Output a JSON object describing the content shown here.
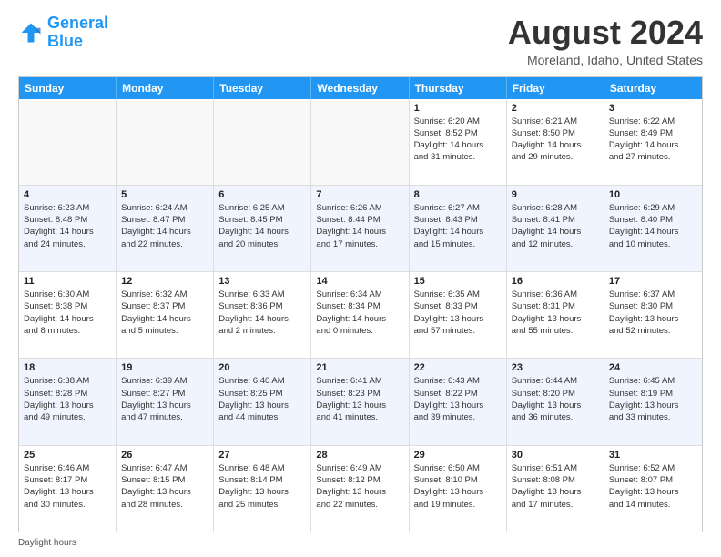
{
  "header": {
    "logo_line1": "General",
    "logo_line2": "Blue",
    "title": "August 2024",
    "subtitle": "Moreland, Idaho, United States"
  },
  "days_of_week": [
    "Sunday",
    "Monday",
    "Tuesday",
    "Wednesday",
    "Thursday",
    "Friday",
    "Saturday"
  ],
  "footer_text": "Daylight hours",
  "rows": [
    {
      "alt": false,
      "cells": [
        {
          "num": "",
          "info": ""
        },
        {
          "num": "",
          "info": ""
        },
        {
          "num": "",
          "info": ""
        },
        {
          "num": "",
          "info": ""
        },
        {
          "num": "1",
          "info": "Sunrise: 6:20 AM\nSunset: 8:52 PM\nDaylight: 14 hours\nand 31 minutes."
        },
        {
          "num": "2",
          "info": "Sunrise: 6:21 AM\nSunset: 8:50 PM\nDaylight: 14 hours\nand 29 minutes."
        },
        {
          "num": "3",
          "info": "Sunrise: 6:22 AM\nSunset: 8:49 PM\nDaylight: 14 hours\nand 27 minutes."
        }
      ]
    },
    {
      "alt": true,
      "cells": [
        {
          "num": "4",
          "info": "Sunrise: 6:23 AM\nSunset: 8:48 PM\nDaylight: 14 hours\nand 24 minutes."
        },
        {
          "num": "5",
          "info": "Sunrise: 6:24 AM\nSunset: 8:47 PM\nDaylight: 14 hours\nand 22 minutes."
        },
        {
          "num": "6",
          "info": "Sunrise: 6:25 AM\nSunset: 8:45 PM\nDaylight: 14 hours\nand 20 minutes."
        },
        {
          "num": "7",
          "info": "Sunrise: 6:26 AM\nSunset: 8:44 PM\nDaylight: 14 hours\nand 17 minutes."
        },
        {
          "num": "8",
          "info": "Sunrise: 6:27 AM\nSunset: 8:43 PM\nDaylight: 14 hours\nand 15 minutes."
        },
        {
          "num": "9",
          "info": "Sunrise: 6:28 AM\nSunset: 8:41 PM\nDaylight: 14 hours\nand 12 minutes."
        },
        {
          "num": "10",
          "info": "Sunrise: 6:29 AM\nSunset: 8:40 PM\nDaylight: 14 hours\nand 10 minutes."
        }
      ]
    },
    {
      "alt": false,
      "cells": [
        {
          "num": "11",
          "info": "Sunrise: 6:30 AM\nSunset: 8:38 PM\nDaylight: 14 hours\nand 8 minutes."
        },
        {
          "num": "12",
          "info": "Sunrise: 6:32 AM\nSunset: 8:37 PM\nDaylight: 14 hours\nand 5 minutes."
        },
        {
          "num": "13",
          "info": "Sunrise: 6:33 AM\nSunset: 8:36 PM\nDaylight: 14 hours\nand 2 minutes."
        },
        {
          "num": "14",
          "info": "Sunrise: 6:34 AM\nSunset: 8:34 PM\nDaylight: 14 hours\nand 0 minutes."
        },
        {
          "num": "15",
          "info": "Sunrise: 6:35 AM\nSunset: 8:33 PM\nDaylight: 13 hours\nand 57 minutes."
        },
        {
          "num": "16",
          "info": "Sunrise: 6:36 AM\nSunset: 8:31 PM\nDaylight: 13 hours\nand 55 minutes."
        },
        {
          "num": "17",
          "info": "Sunrise: 6:37 AM\nSunset: 8:30 PM\nDaylight: 13 hours\nand 52 minutes."
        }
      ]
    },
    {
      "alt": true,
      "cells": [
        {
          "num": "18",
          "info": "Sunrise: 6:38 AM\nSunset: 8:28 PM\nDaylight: 13 hours\nand 49 minutes."
        },
        {
          "num": "19",
          "info": "Sunrise: 6:39 AM\nSunset: 8:27 PM\nDaylight: 13 hours\nand 47 minutes."
        },
        {
          "num": "20",
          "info": "Sunrise: 6:40 AM\nSunset: 8:25 PM\nDaylight: 13 hours\nand 44 minutes."
        },
        {
          "num": "21",
          "info": "Sunrise: 6:41 AM\nSunset: 8:23 PM\nDaylight: 13 hours\nand 41 minutes."
        },
        {
          "num": "22",
          "info": "Sunrise: 6:43 AM\nSunset: 8:22 PM\nDaylight: 13 hours\nand 39 minutes."
        },
        {
          "num": "23",
          "info": "Sunrise: 6:44 AM\nSunset: 8:20 PM\nDaylight: 13 hours\nand 36 minutes."
        },
        {
          "num": "24",
          "info": "Sunrise: 6:45 AM\nSunset: 8:19 PM\nDaylight: 13 hours\nand 33 minutes."
        }
      ]
    },
    {
      "alt": false,
      "cells": [
        {
          "num": "25",
          "info": "Sunrise: 6:46 AM\nSunset: 8:17 PM\nDaylight: 13 hours\nand 30 minutes."
        },
        {
          "num": "26",
          "info": "Sunrise: 6:47 AM\nSunset: 8:15 PM\nDaylight: 13 hours\nand 28 minutes."
        },
        {
          "num": "27",
          "info": "Sunrise: 6:48 AM\nSunset: 8:14 PM\nDaylight: 13 hours\nand 25 minutes."
        },
        {
          "num": "28",
          "info": "Sunrise: 6:49 AM\nSunset: 8:12 PM\nDaylight: 13 hours\nand 22 minutes."
        },
        {
          "num": "29",
          "info": "Sunrise: 6:50 AM\nSunset: 8:10 PM\nDaylight: 13 hours\nand 19 minutes."
        },
        {
          "num": "30",
          "info": "Sunrise: 6:51 AM\nSunset: 8:08 PM\nDaylight: 13 hours\nand 17 minutes."
        },
        {
          "num": "31",
          "info": "Sunrise: 6:52 AM\nSunset: 8:07 PM\nDaylight: 13 hours\nand 14 minutes."
        }
      ]
    }
  ]
}
